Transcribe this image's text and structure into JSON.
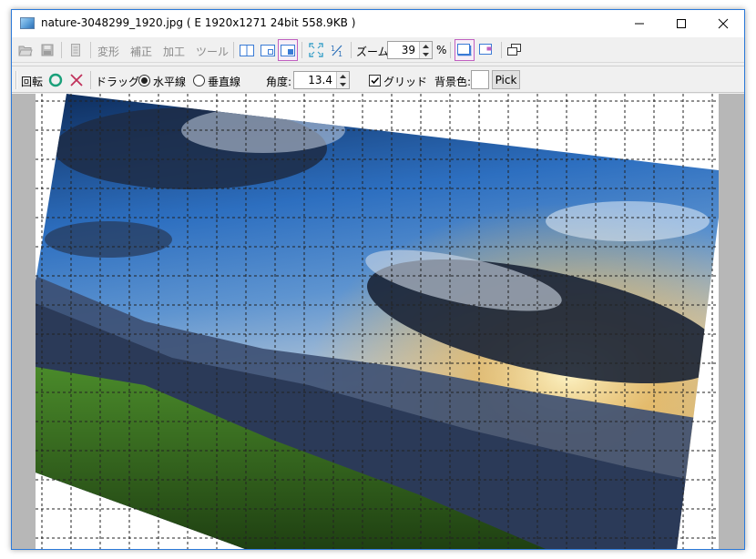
{
  "window": {
    "title": "nature-3048299_1920.jpg  ( E  1920x1271  24bit  558.9KB )"
  },
  "toolbar": {
    "menus": [
      "変形",
      "補正",
      "加工",
      "ツール"
    ],
    "zoom_label": "ズーム:",
    "zoom_value": "39",
    "zoom_unit": "%"
  },
  "rotate_bar": {
    "rotate_label": "回転",
    "drag_label": "ドラッグ:",
    "horizontal_label": "水平線",
    "vertical_label": "垂直線",
    "angle_label": "角度:",
    "angle_value": "13.4",
    "grid_label": "グリッド",
    "grid_checked": true,
    "background_label": "背景色:",
    "pick_label": "Pick",
    "drag_mode": "horizontal"
  },
  "colors": {
    "title_border": "#2b79d9",
    "highlight_button": "#c060c0",
    "canvas_gray": "#b7b7b7",
    "ok_green": "#1aa07a",
    "cancel_red": "#c0305a"
  },
  "icons": {
    "app": "image-file-icon",
    "minimize": "minimize-icon",
    "maximize": "maximize-icon",
    "close": "close-icon"
  }
}
